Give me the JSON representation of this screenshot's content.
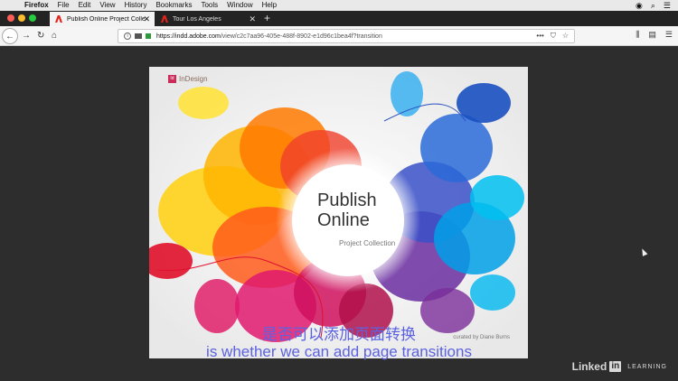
{
  "menubar": {
    "app": "Firefox",
    "items": [
      "File",
      "Edit",
      "View",
      "History",
      "Bookmarks",
      "Tools",
      "Window",
      "Help"
    ],
    "icons": [
      "circle-icon",
      "search-icon",
      "list-icon"
    ]
  },
  "tabs": [
    {
      "title": "Publish Online Project Collectio",
      "active": true
    },
    {
      "title": "Tour Los Angeles",
      "active": false
    }
  ],
  "navbar": {
    "url_host": "https://indd.adobe.com",
    "url_path": "/view/c2c7aa96-405e-488f-8902-e1d96c1bea4f?transition"
  },
  "slide": {
    "logo_mark": "Id",
    "logo_text": "InDesign",
    "title_line1": "Publish",
    "title_line2": "Online",
    "subtitle": "Project Collection",
    "credit": "curated by Diane Burns"
  },
  "subtitles": {
    "chinese": "是否可以添加页面转换",
    "english": "is whether we can add page transitions"
  },
  "watermark": {
    "brand_a": "Linked",
    "brand_b": "in",
    "suffix": "LEARNING"
  },
  "colors": {
    "subtitle": "#5c62e0",
    "lock_green": "#2a9a3a"
  }
}
